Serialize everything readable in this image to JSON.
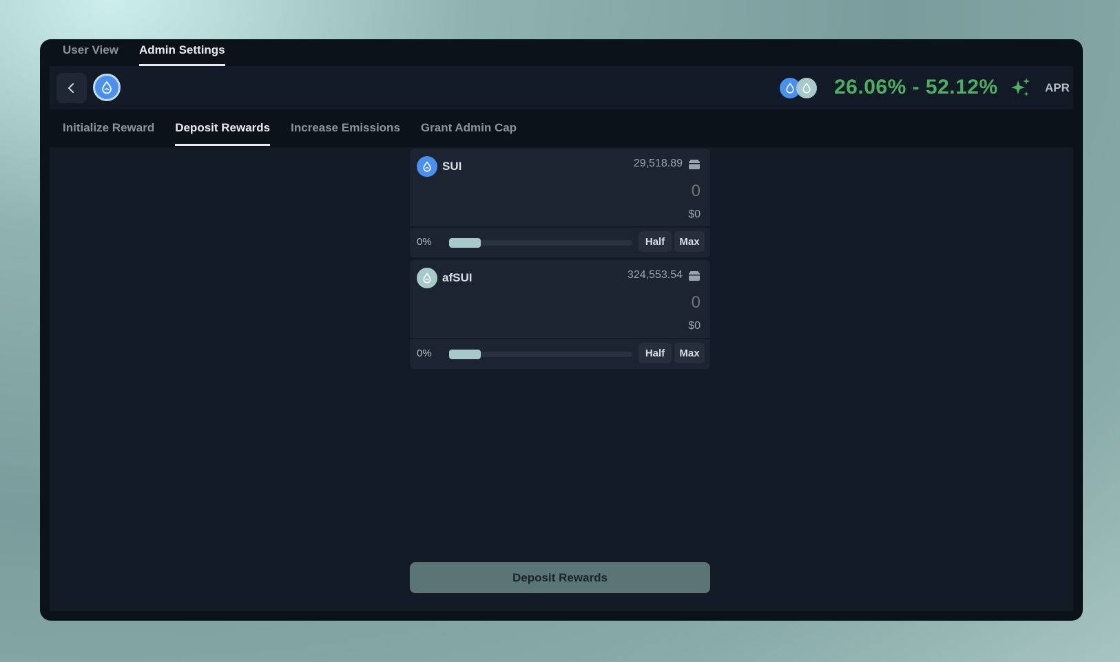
{
  "top_tabs": [
    {
      "label": "User View",
      "active": false
    },
    {
      "label": "Admin Settings",
      "active": true
    }
  ],
  "header": {
    "apr_range": "26.06% - 52.12%",
    "apr_label": "APR"
  },
  "sub_tabs": [
    {
      "label": "Initialize Reward",
      "active": false
    },
    {
      "label": "Deposit Rewards",
      "active": true
    },
    {
      "label": "Increase Emissions",
      "active": false
    },
    {
      "label": "Grant Admin Cap",
      "active": false
    }
  ],
  "cards": [
    {
      "token": "SUI",
      "balance": "29,518.89",
      "amount_placeholder": "0",
      "usd_value": "$0",
      "percent": "0%",
      "half_label": "Half",
      "max_label": "Max",
      "icon_color": "#4a90f0"
    },
    {
      "token": "afSUI",
      "balance": "324,553.54",
      "amount_placeholder": "0",
      "usd_value": "$0",
      "percent": "0%",
      "half_label": "Half",
      "max_label": "Max",
      "icon_color": "#a7c9c9"
    }
  ],
  "deposit_button_label": "Deposit Rewards",
  "colors": {
    "apr_green": "#4caf62",
    "accent_teal": "#a7c9c9",
    "sui_blue": "#4a90f0"
  }
}
